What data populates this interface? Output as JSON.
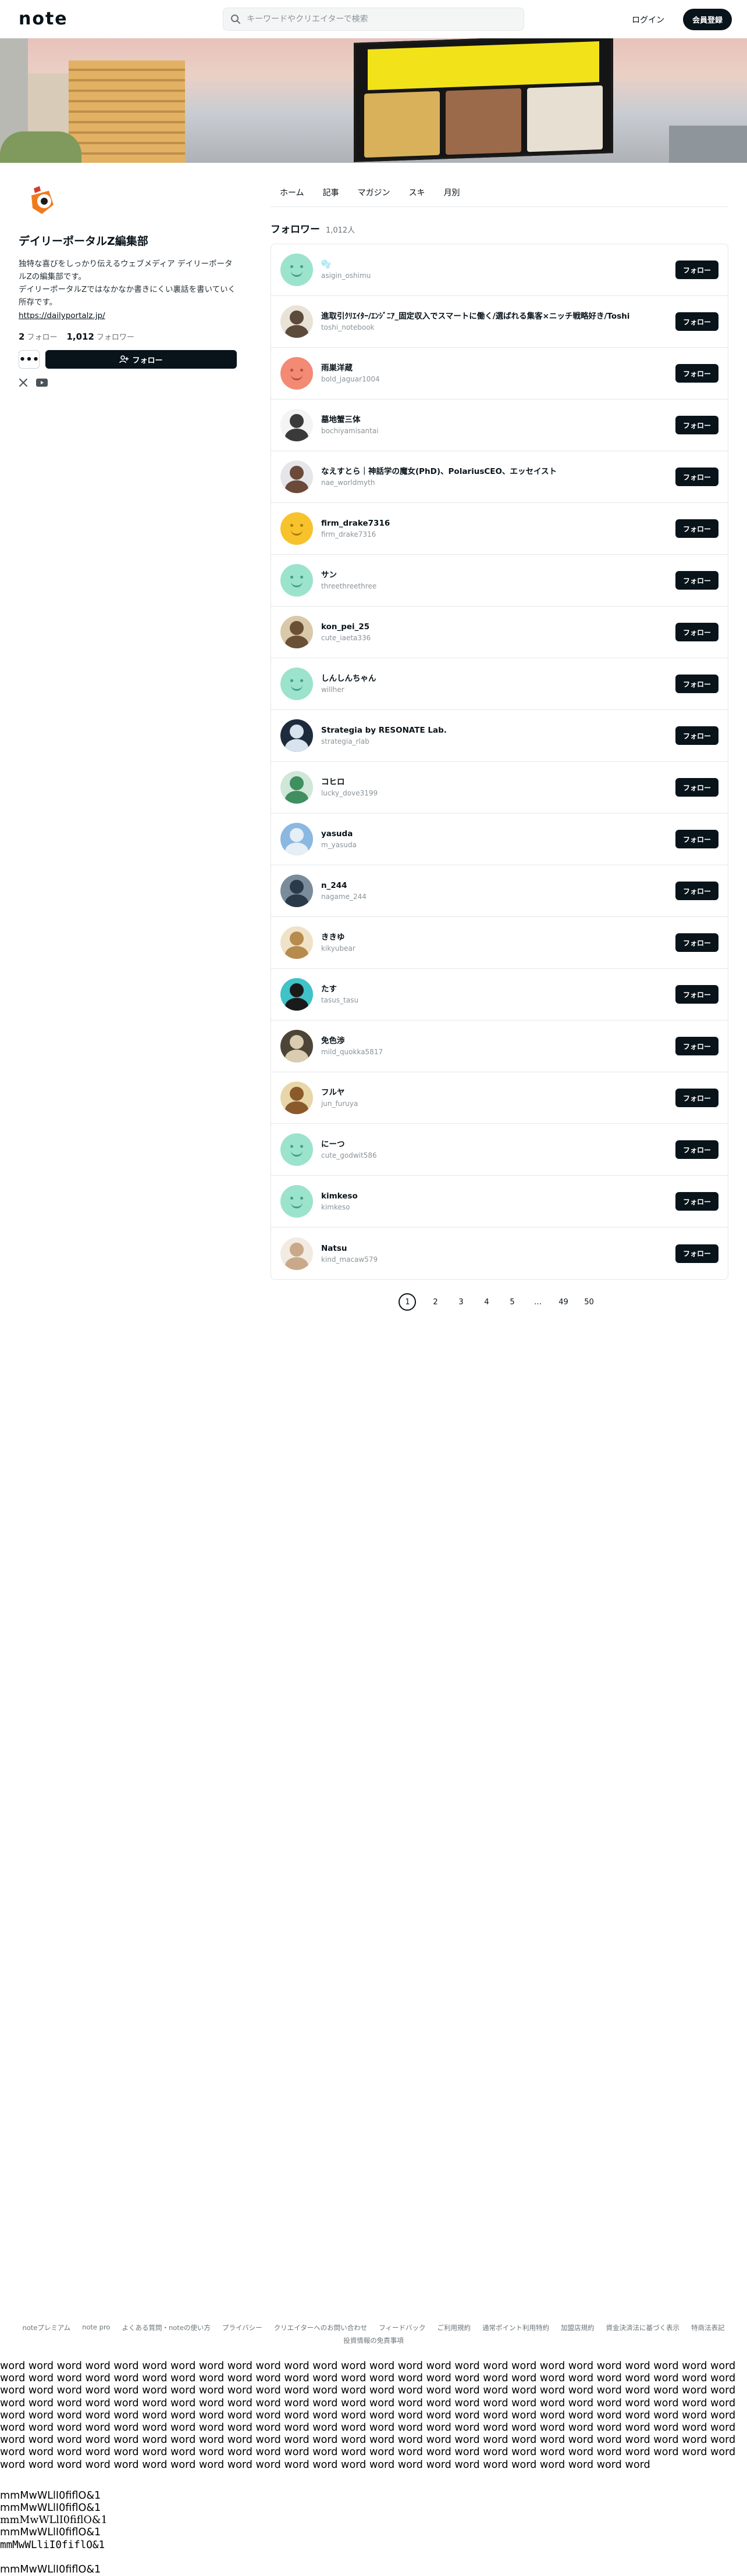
{
  "header": {
    "logo": "note",
    "search_placeholder": "キーワードやクリエイターで検索",
    "login_label": "ログイン",
    "signup_label": "会員登録"
  },
  "profile": {
    "name": "デイリーポータルZ編集部",
    "description_lines": [
      "独特な喜びをしっかり伝えるウェブメディア デイリーポータ",
      "ルZの編集部です。",
      "デイリーポータルZではなかなか書きにくい裏話を書いていく",
      "所存です。"
    ],
    "link": "https://dailyportalz.jp/",
    "follow_count": "2",
    "follow_label": "フォロー",
    "follower_count": "1,012",
    "follower_label": "フォロワー",
    "more_label": "•••",
    "follow_button": "フォロー",
    "sns_icons": [
      "x-icon",
      "youtube-icon"
    ]
  },
  "tabs": [
    "ホーム",
    "記事",
    "マガジン",
    "スキ",
    "月別"
  ],
  "followers_section": {
    "title": "フォロワー",
    "count": "1,012人",
    "follow_button": "フォロー"
  },
  "followers": [
    {
      "name": "🫧",
      "id": "asigin_oshimu",
      "avatar": "mint"
    },
    {
      "name": "進取引ｸﾘｴｲﾀｰ/ｴﾝｼﾞﾆｱ_固定収入でスマートに働く/選ばれる集客×ニッチ戦略好き/Toshi",
      "id": "toshi_notebook",
      "avatar": "photo",
      "c1": "#e9e2d6",
      "c2": "#5c4b3b"
    },
    {
      "name": "雨巣洋蔵",
      "id": "bold_jaguar1004",
      "avatar": "coral"
    },
    {
      "name": "墓地蟹三体",
      "id": "bochiyamisantai",
      "avatar": "photo",
      "c1": "#f4f4f4",
      "c2": "#3a3a3a"
    },
    {
      "name": "なえすとら｜神話学の魔女(PhD)、PolariusCEO、エッセイスト",
      "id": "nae_worldmyth",
      "avatar": "photo",
      "c1": "#e6e6ea",
      "c2": "#6b4a3a"
    },
    {
      "name": "firm_drake7316",
      "id": "firm_drake7316",
      "avatar": "yellow"
    },
    {
      "name": "サン",
      "id": "threethreethree",
      "avatar": "mint"
    },
    {
      "name": "kon_pei_25",
      "id": "cute_iaeta336",
      "avatar": "photo",
      "c1": "#d9c9a8",
      "c2": "#6a5036"
    },
    {
      "name": "しんしんちゃん",
      "id": "willher",
      "avatar": "mint"
    },
    {
      "name": "Strategia by RESONATE Lab.",
      "id": "strategia_rlab",
      "avatar": "photo",
      "c1": "#1d2b3c",
      "c2": "#d7e3ef"
    },
    {
      "name": "コヒロ",
      "id": "lucky_dove3199",
      "avatar": "photo",
      "c1": "#cfe7d8",
      "c2": "#3f8f5f"
    },
    {
      "name": "yasuda",
      "id": "m_yasuda",
      "avatar": "photo",
      "c1": "#8bb8e0",
      "c2": "#e6eef6"
    },
    {
      "name": "n_244",
      "id": "nagame_244",
      "avatar": "photo",
      "c1": "#7a8c9c",
      "c2": "#2b3a48"
    },
    {
      "name": "ききゆ",
      "id": "kikyubear",
      "avatar": "photo",
      "c1": "#f0e2c8",
      "c2": "#b78a4e"
    },
    {
      "name": "たす",
      "id": "tasus_tasu",
      "avatar": "photo",
      "c1": "#3fc2c8",
      "c2": "#1a1a1a"
    },
    {
      "name": "免色渉",
      "id": "mild_quokka5817",
      "avatar": "photo",
      "c1": "#4c4436",
      "c2": "#d9ccb0"
    },
    {
      "name": "フルヤ",
      "id": "jun_furuya",
      "avatar": "photo",
      "c1": "#e8d6a8",
      "c2": "#8a5a2a"
    },
    {
      "name": "にーつ",
      "id": "cute_godwit586",
      "avatar": "mint"
    },
    {
      "name": "kimkeso",
      "id": "kimkeso",
      "avatar": "mint"
    },
    {
      "name": "Natsu",
      "id": "kind_macaw579",
      "avatar": "photo",
      "c1": "#f1ebe3",
      "c2": "#c9a98a"
    }
  ],
  "pagination": [
    "1",
    "2",
    "3",
    "4",
    "5",
    "…",
    "49",
    "50"
  ],
  "footer": {
    "links": [
      "noteプレミアム",
      "note pro",
      "よくある質問・noteの使い方",
      "プライバシー",
      "クリエイターへのお問い合わせ",
      "フィードバック",
      "ご利用規約",
      "通常ポイント利用特約",
      "加盟店規約",
      "資金決済法に基づく表示",
      "特商法表記"
    ],
    "second_line": "投資情報の免責事項"
  },
  "filler": {
    "word_text": "word word word word word word word word word word word word word word word word word word word word word word word word word word word word word word word word word word word word word word word word word word word word word word word word word word word word word word word word word word word word word word word word word word word word word word word word word word word word word word word word word word word word word word word word word word word word word word word word word word word word word word word word word word word word word word word word word word word word word word word word word word word word word word word word word word word word word word word word word word word word word word word word word word word word word word word word word word word word word word word word word word word word word word word word word word word word word word word word word word word word word word word word word word word word word word word word word word word word word word word word word word word word word word word word word word word word word word word word word word word word word word word word word word word word word word word",
    "mono_lines": [
      "mmMwWLlI0fiflO&1",
      "mmMwWLlI0fiflO&1",
      "mmMwWLlI0fiflO&1",
      "mmMwWLlI0fiflO&1",
      "mmMwWLliI0fiflO&1"
    ],
    "mono_extra": "mmMwWLlI0fiflO&1"
  }
}
